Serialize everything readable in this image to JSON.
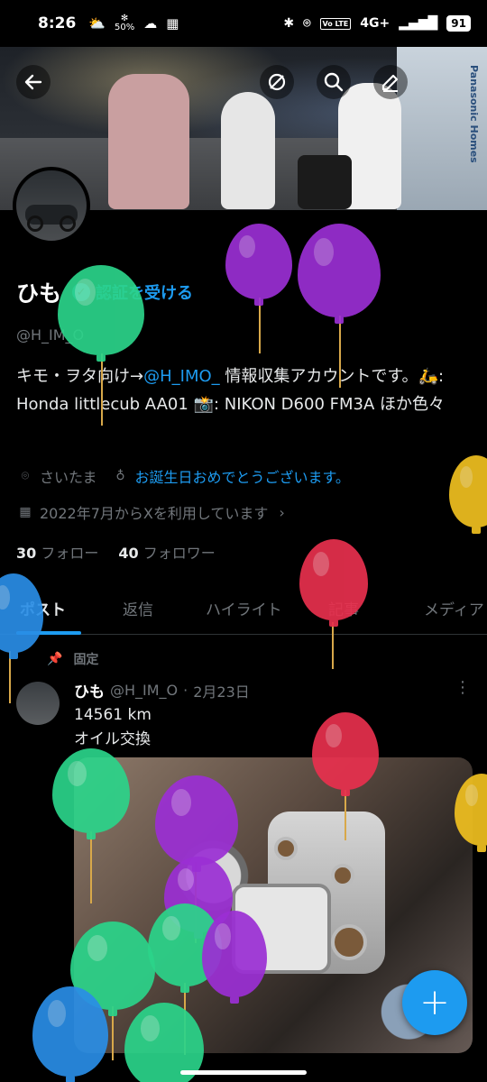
{
  "status_bar": {
    "time": "8:26",
    "speed": "50%",
    "network": "4G+",
    "volte": "Vo LTE",
    "battery": "91"
  },
  "profile": {
    "name": "ひも",
    "verify_label": "認証を受ける",
    "handle": "@H_IM_O",
    "bio_prefix": "キモ・ヲタ向け→",
    "bio_link": "@H_IMO_",
    "bio_rest": " 情報収集アカウントです。🛵: Honda littlecub AA01 📸: NIKON D600 FM3A ほか色々",
    "location": "さいたま",
    "birthday": "お誕生日おめでとうございます。",
    "joined": "2022年7月からXを利用しています",
    "following_count": "30",
    "following_label": "フォロー",
    "followers_count": "40",
    "followers_label": "フォロワー"
  },
  "banner": {
    "building_text": "Panasonic Homes"
  },
  "tabs": [
    {
      "label": "ポスト"
    },
    {
      "label": "返信"
    },
    {
      "label": "ハイライト"
    },
    {
      "label": "記事"
    },
    {
      "label": "メディア"
    }
  ],
  "post": {
    "pinned_label": "固定",
    "name": "ひも",
    "handle": "@H_IM_O",
    "sep": "·",
    "date": "2月23日",
    "line1": "14561 km",
    "line2": "オイル交換"
  },
  "icons": {
    "back": "back-arrow-icon",
    "grok": "grok-icon",
    "search": "search-icon",
    "compose": "compose-icon",
    "location": "location-pin-icon",
    "birthday": "balloon-icon",
    "calendar": "calendar-icon",
    "pin": "pin-icon",
    "more": "more-vertical-icon",
    "fab": "plus-icon"
  },
  "colors": {
    "accent": "#1d9bf0",
    "background": "#000000",
    "muted_text": "#71767b"
  }
}
